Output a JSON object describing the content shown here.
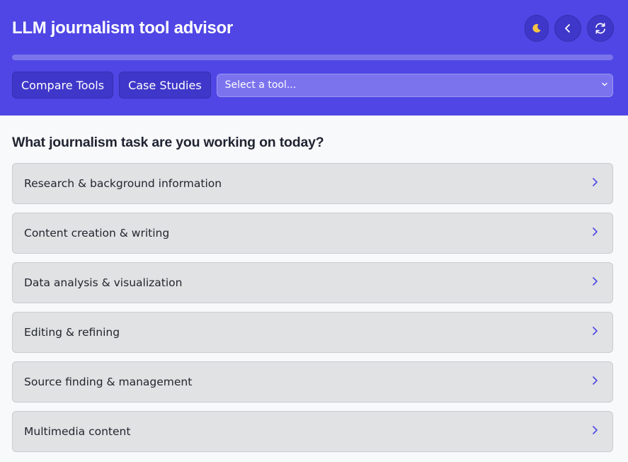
{
  "app": {
    "title": "LLM journalism tool advisor"
  },
  "header": {
    "icons": {
      "theme": "moon-icon",
      "back": "chevron-left-icon",
      "refresh": "refresh-icon"
    },
    "progress": 0.0
  },
  "controls": {
    "compare_label": "Compare Tools",
    "case_studies_label": "Case Studies",
    "tool_select": {
      "selected": "Select a tool...",
      "icon": "chevron-down-icon"
    }
  },
  "main": {
    "question": "What journalism task are you working on today?",
    "tasks": [
      {
        "label": "Research & background information"
      },
      {
        "label": "Content creation & writing"
      },
      {
        "label": "Data analysis & visualization"
      },
      {
        "label": "Editing & refining"
      },
      {
        "label": "Source finding & management"
      },
      {
        "label": "Multimedia content"
      }
    ]
  },
  "colors": {
    "header_bg": "#4f46e5",
    "button_bg": "#3f37c9",
    "progress_track": "#a5b4fc",
    "chevron": "#4f46e5",
    "task_bg": "#e0e2e3"
  }
}
